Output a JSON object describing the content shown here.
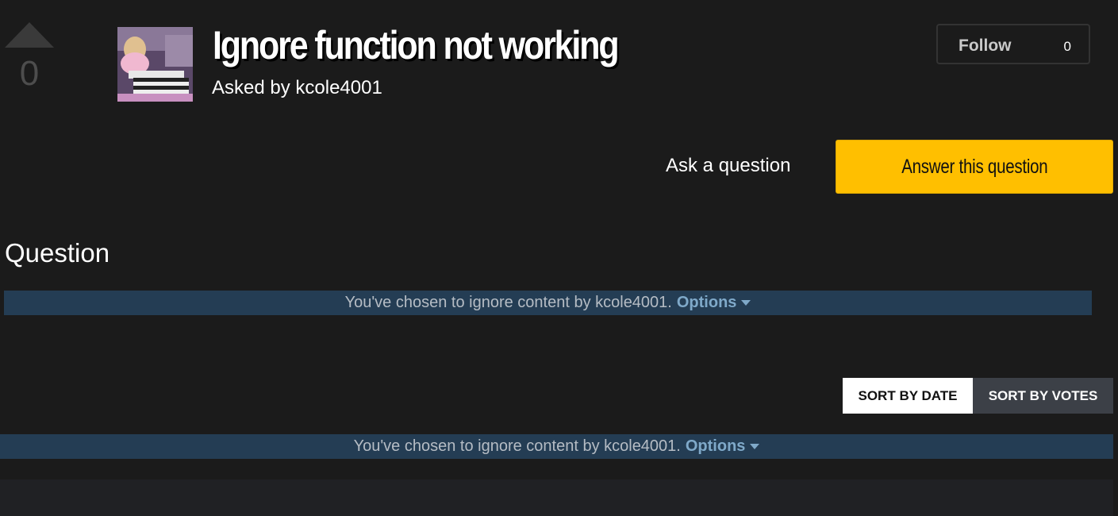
{
  "vote": {
    "count": "0"
  },
  "question": {
    "title": "Ignore function not working",
    "asked_by": "Asked by kcole4001"
  },
  "follow": {
    "label": "Follow",
    "count": "0"
  },
  "actions": {
    "ask_label": "Ask a question",
    "answer_label": "Answer this question"
  },
  "section": {
    "heading": "Question"
  },
  "ignore_notice": {
    "text": "You've chosen to ignore content by kcole4001.",
    "options_label": "Options"
  },
  "sort": {
    "by_date": "SORT BY DATE",
    "by_votes": "SORT BY VOTES"
  },
  "colors": {
    "background": "#1b1b1b",
    "accent": "#ffbf00",
    "ignore_bar": "#243d54",
    "link": "#7fa9c9"
  }
}
